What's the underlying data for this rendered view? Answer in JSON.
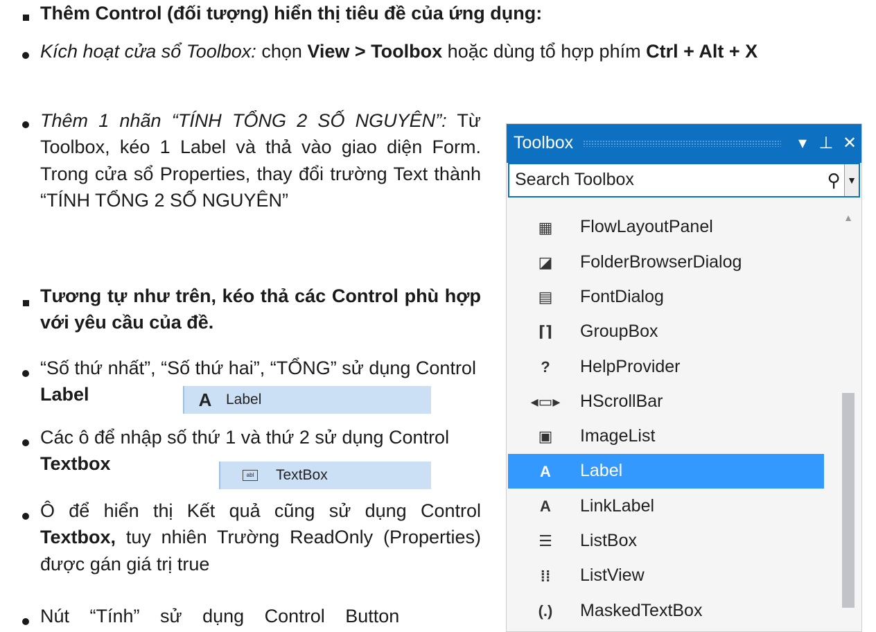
{
  "doc": {
    "b1": "Thêm Control (đối tượng) hiển thị tiêu đề của ứng dụng:",
    "b2": {
      "i": "Kích hoạt cửa sổ Toolbox:",
      "t1": "  chọn ",
      "k1": "View > Toolbox",
      "t2": " hoặc dùng tổ hợp phím ",
      "k2": "Ctrl + Alt + X"
    },
    "b3": {
      "i": "Thêm 1 nhãn “TÍNH TỔNG 2 SỐ NGUYÊN”:",
      "t": " Từ Toolbox, kéo 1 Label và thả vào giao diện Form. Trong cửa sổ Properties, thay đổi trường Text thành “TÍNH TỔNG 2 SỐ NGUYÊN”"
    },
    "b4": "Tương tự như trên, kéo thả các Control phù hợp với yêu cầu của đề.",
    "b5": {
      "t": "“Số thứ nhất”, “Số thứ hai”, “TỔNG” sử dụng Control ",
      "k": "Label"
    },
    "b6": {
      "t": "Các ô để nhập số thứ 1 và thứ 2 sử dụng Control ",
      "k": "Textbox"
    },
    "b7": {
      "t1": "Ô để hiển thị Kết quả cũng sử dụng Control ",
      "k": "Textbox,",
      "t2": " tuy nhiên Trường ReadOnly (Properties) được gán giá trị true"
    },
    "b8": "Nút “Tính” sử dụng Control Button",
    "chip_label": "Label",
    "chip_textbox": "TextBox"
  },
  "toolbox": {
    "title": "Toolbox",
    "search_placeholder": "Search Toolbox",
    "items": [
      {
        "label": "FlowLayoutPanel",
        "icon": "flow-layout-panel-icon",
        "glyph": "▦",
        "selected": false
      },
      {
        "label": "FolderBrowserDialog",
        "icon": "folder-browser-dialog-icon",
        "glyph": "◪",
        "selected": false
      },
      {
        "label": "FontDialog",
        "icon": "font-dialog-icon",
        "glyph": "▤",
        "selected": false
      },
      {
        "label": "GroupBox",
        "icon": "group-box-icon",
        "glyph": "⌈⌉",
        "selected": false
      },
      {
        "label": "HelpProvider",
        "icon": "help-provider-icon",
        "glyph": "?",
        "selected": false
      },
      {
        "label": "HScrollBar",
        "icon": "hscrollbar-icon",
        "glyph": "◂▭▸",
        "selected": false
      },
      {
        "label": "ImageList",
        "icon": "image-list-icon",
        "glyph": "▣",
        "selected": false
      },
      {
        "label": "Label",
        "icon": "label-icon",
        "glyph": "A",
        "selected": true
      },
      {
        "label": "LinkLabel",
        "icon": "link-label-icon",
        "glyph": "A",
        "selected": false
      },
      {
        "label": "ListBox",
        "icon": "list-box-icon",
        "glyph": "☰",
        "selected": false
      },
      {
        "label": "ListView",
        "icon": "list-view-icon",
        "glyph": "⁞⁞",
        "selected": false
      },
      {
        "label": "MaskedTextBox",
        "icon": "masked-textbox-icon",
        "glyph": "(.)",
        "selected": false
      }
    ]
  }
}
